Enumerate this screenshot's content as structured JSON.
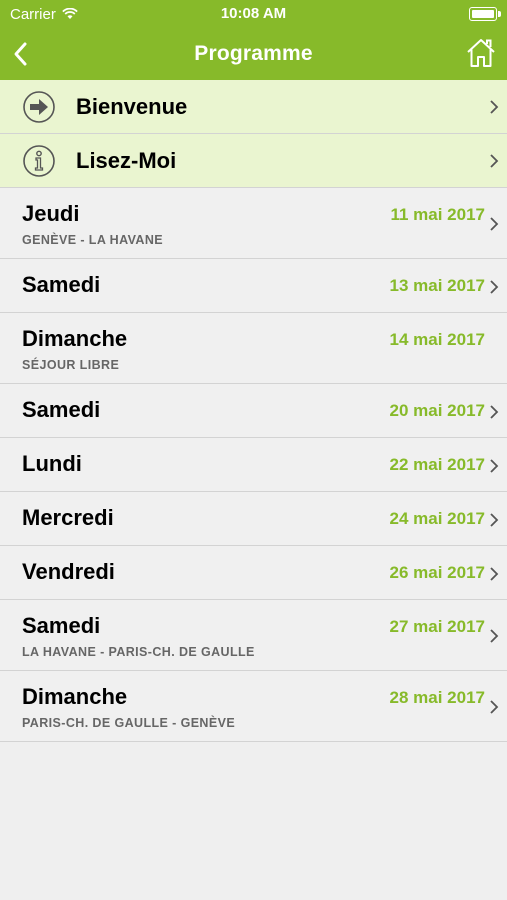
{
  "status": {
    "carrier": "Carrier",
    "time": "10:08 AM"
  },
  "nav": {
    "title": "Programme"
  },
  "menu": [
    {
      "label": "Bienvenue",
      "icon": "arrow-right-circle-icon"
    },
    {
      "label": "Lisez-Moi",
      "icon": "info-icon"
    }
  ],
  "days": [
    {
      "day": "Jeudi",
      "date": "11 mai 2017",
      "subtitle": "GENÈVE - LA HAVANE",
      "chevron": true
    },
    {
      "day": "Samedi",
      "date": "13 mai 2017",
      "subtitle": "",
      "chevron": true
    },
    {
      "day": "Dimanche",
      "date": "14 mai 2017",
      "subtitle": "SÉJOUR LIBRE",
      "chevron": false
    },
    {
      "day": "Samedi",
      "date": "20 mai 2017",
      "subtitle": "",
      "chevron": true
    },
    {
      "day": "Lundi",
      "date": "22 mai 2017",
      "subtitle": "",
      "chevron": true
    },
    {
      "day": "Mercredi",
      "date": "24 mai 2017",
      "subtitle": "",
      "chevron": true
    },
    {
      "day": "Vendredi",
      "date": "26 mai 2017",
      "subtitle": "",
      "chevron": true
    },
    {
      "day": "Samedi",
      "date": "27 mai 2017",
      "subtitle": "LA HAVANE - PARIS-CH. DE GAULLE",
      "chevron": true
    },
    {
      "day": "Dimanche",
      "date": "28 mai 2017",
      "subtitle": "PARIS-CH. DE GAULLE - GENÈVE",
      "chevron": true
    }
  ],
  "colors": {
    "accent": "#87ba2a",
    "highlight_row": "#eaf5d0",
    "background": "#efefef"
  }
}
